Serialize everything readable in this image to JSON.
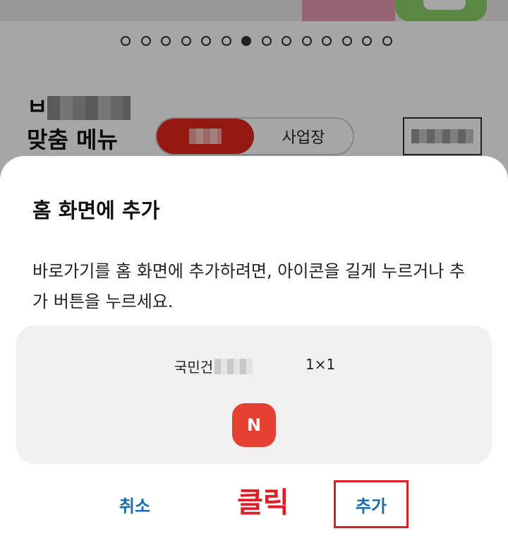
{
  "background": {
    "page_indicator": {
      "total": 14,
      "active": 6
    },
    "menu_title": {
      "line1": "ㅂ",
      "line2": "맞춤 메뉴"
    },
    "segment": {
      "right_label": "사업장"
    }
  },
  "dialog": {
    "title": "홈 화면에 추가",
    "description": "바로가기를 홈 화면에 추가하려면, 아이콘을 길게 누르거나 추가 버튼을 누르세요.",
    "widget": {
      "name": "국민건",
      "size": "1×1",
      "icon_letter": "N",
      "icon_color": "#e64032"
    },
    "cancel_label": "취소",
    "add_label": "추가"
  },
  "annotation": {
    "click_label": "클릭",
    "color": "#e11c24"
  }
}
